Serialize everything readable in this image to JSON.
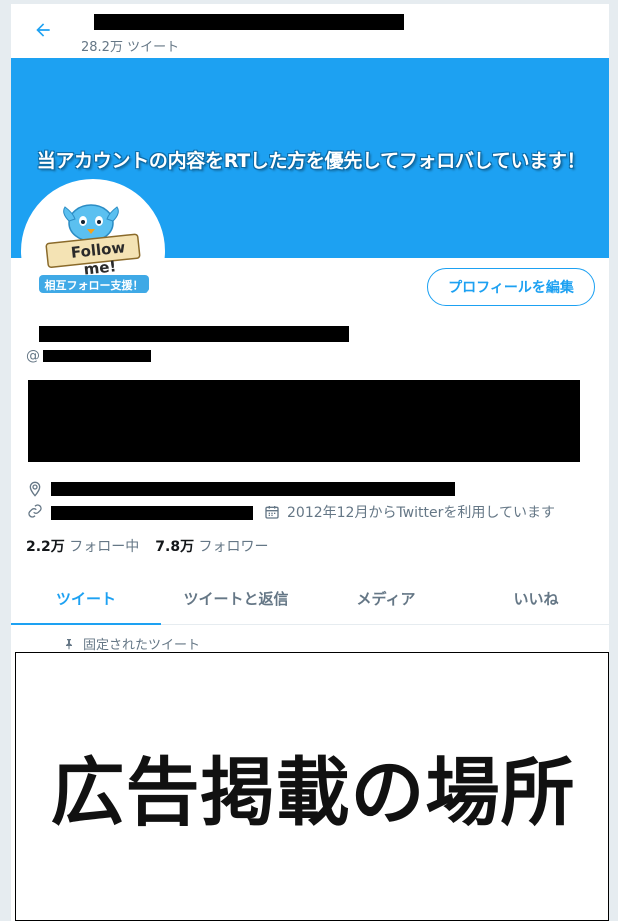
{
  "header": {
    "tweet_count": "28.2万 ツイート"
  },
  "banner": {
    "text": "当アカウントの内容をRTした方を優先してフォロバしています！",
    "color": "#1da1f2"
  },
  "avatar": {
    "top_text": "Follow me!",
    "bottom_text": "相互フォロー支援！"
  },
  "profile": {
    "edit_button": "プロフィールを編集",
    "handle_prefix": "@",
    "joined": "2012年12月からTwitterを利用しています"
  },
  "stats": {
    "following_count": "2.2万",
    "following_label": "フォロー中",
    "followers_count": "7.8万",
    "followers_label": "フォロワー"
  },
  "tabs": [
    {
      "label": "ツイート",
      "active": true
    },
    {
      "label": "ツイートと返信",
      "active": false
    },
    {
      "label": "メディア",
      "active": false
    },
    {
      "label": "いいね",
      "active": false
    }
  ],
  "pinned": {
    "label": "固定されたツイート"
  },
  "ad": {
    "text": "広告掲載の場所"
  },
  "colors": {
    "accent": "#1da1f2",
    "muted": "#657786"
  }
}
